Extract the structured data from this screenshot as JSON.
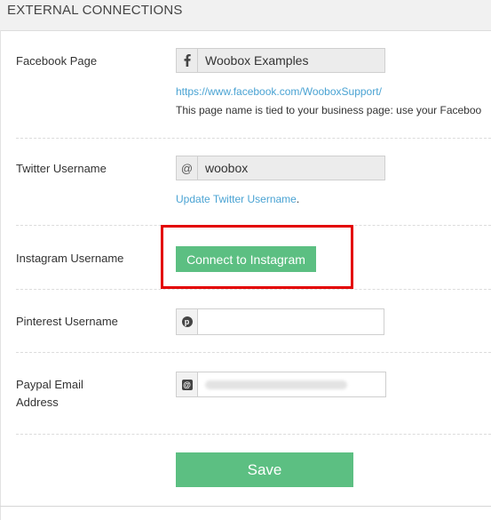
{
  "header": {
    "title": "EXTERNAL CONNECTIONS"
  },
  "facebook": {
    "label": "Facebook Page",
    "icon": "facebook-icon",
    "value": "Woobox Examples",
    "link": "https://www.facebook.com/WooboxSupport/",
    "help": "This page name is tied to your business page: use your Faceboo"
  },
  "twitter": {
    "label": "Twitter Username",
    "icon": "at-icon",
    "value": "woobox",
    "update_link": "Update Twitter Username",
    "update_suffix": "."
  },
  "instagram": {
    "label": "Instagram Username",
    "button": "Connect to Instagram"
  },
  "pinterest": {
    "label": "Pinterest Username",
    "icon": "pinterest-icon",
    "value": ""
  },
  "paypal": {
    "label_line1": "Paypal Email",
    "label_line2": "Address",
    "icon": "email-at-icon"
  },
  "actions": {
    "save": "Save"
  },
  "colors": {
    "accent_green": "#5cbf82",
    "link_blue": "#4aa3d3",
    "highlight_red": "#e30000"
  }
}
